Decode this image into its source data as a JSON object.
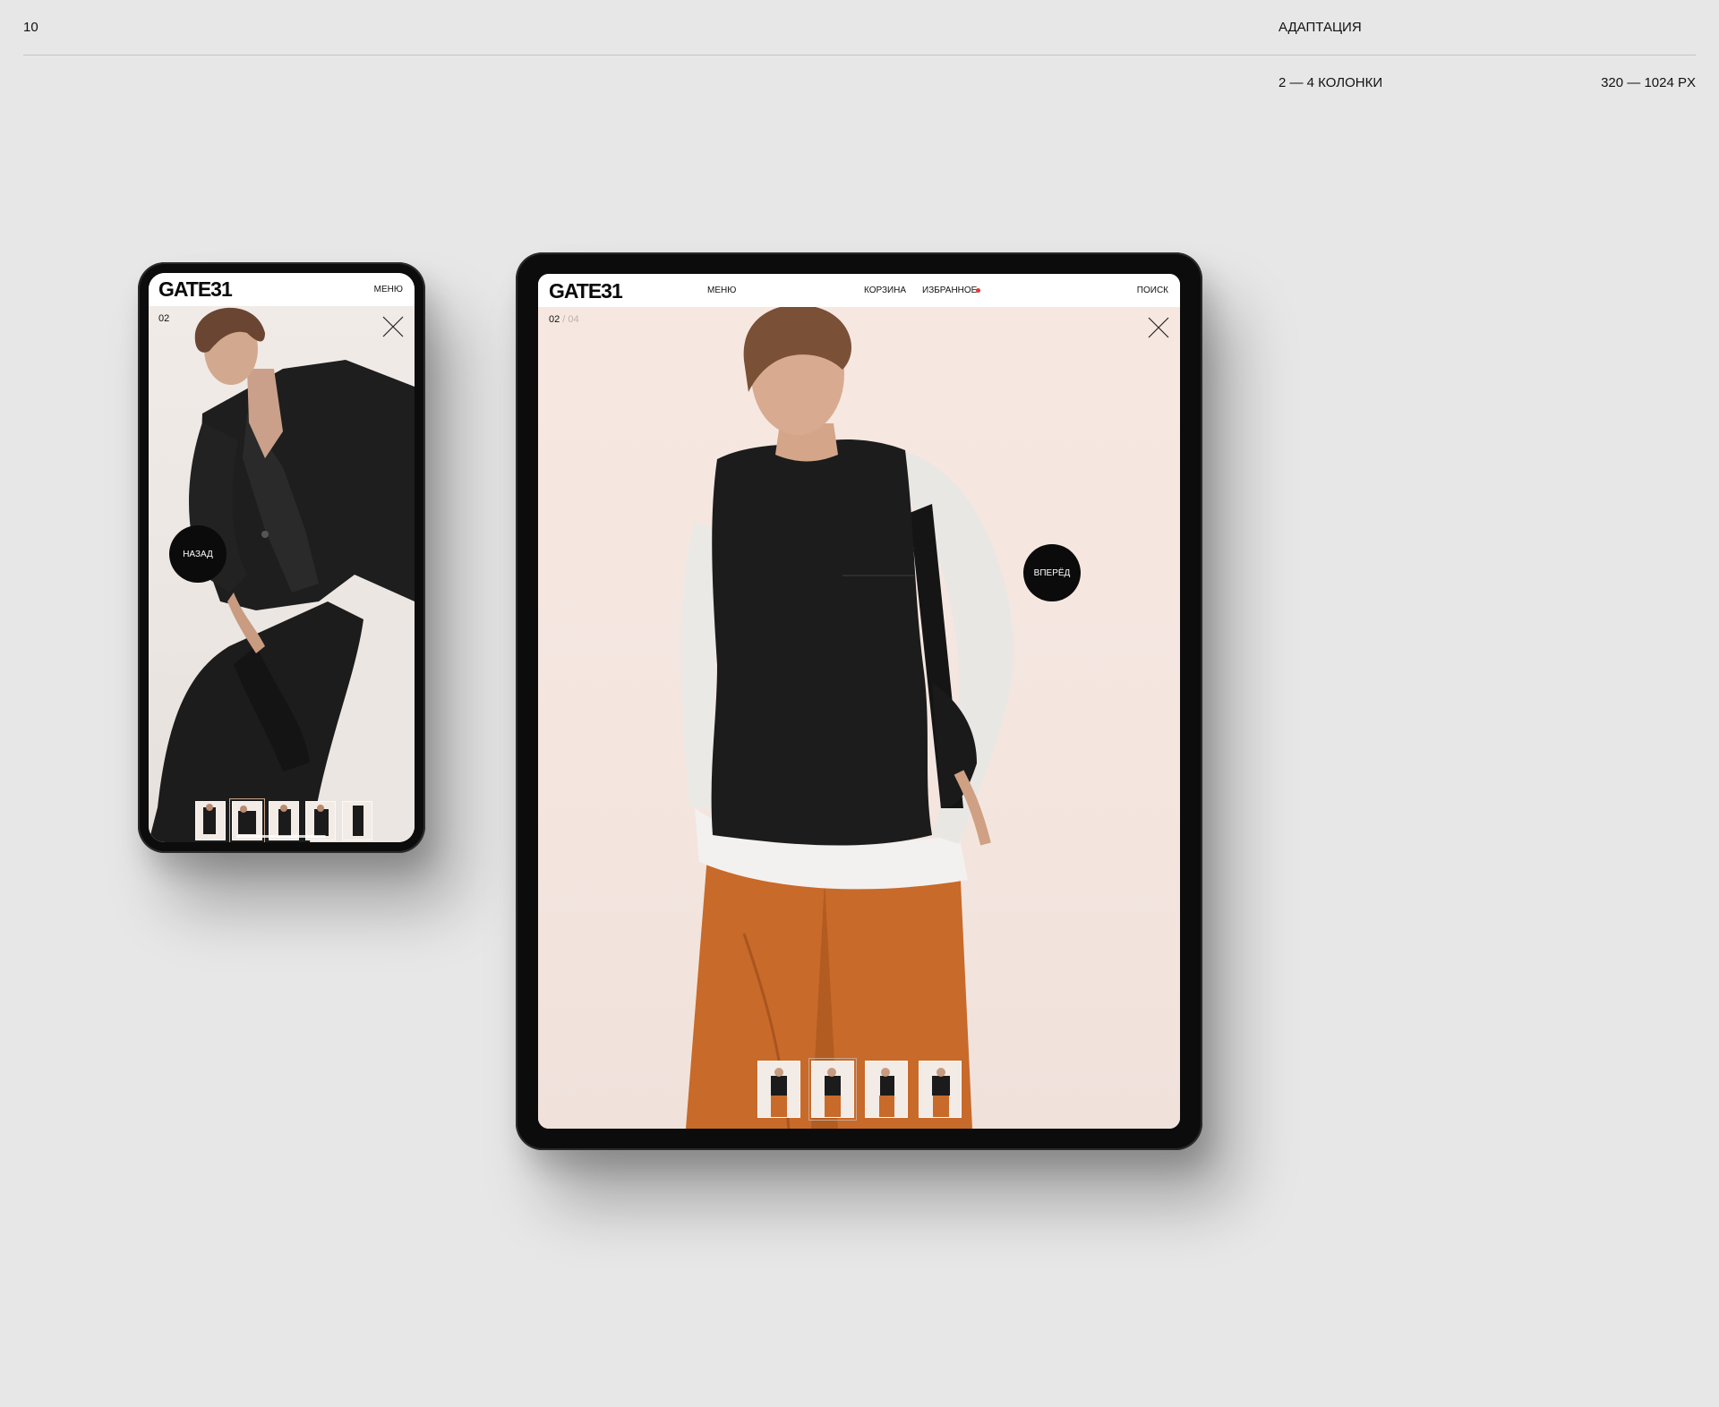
{
  "page": {
    "number": "10",
    "section": "АДАПТАЦИЯ",
    "columns": "2 — 4 КОЛОНКИ",
    "range": "320 — 1024 PX"
  },
  "brand": {
    "logo": "GATE31",
    "accent_dot_color": "#e53935",
    "button_color": "#0b0b0b"
  },
  "phone": {
    "header": {
      "menu": "МЕНЮ"
    },
    "counter": {
      "current": "02"
    },
    "back_button": "НАЗАД",
    "thumbnails_count": 5,
    "active_thumbnail": 2
  },
  "tablet": {
    "header": {
      "menu": "МЕНЮ",
      "cart": "КОРЗИНА",
      "favorites": "ИЗБРАННОЕ",
      "search": "ПОИСК"
    },
    "counter": {
      "current": "02",
      "separator": " / ",
      "total": "04"
    },
    "next_button": "ВПЕРЁД",
    "thumbnails_count": 4,
    "active_thumbnail": 2
  },
  "icons": {
    "close": "close-icon",
    "favorites_indicator": "favorites-dot-icon"
  }
}
